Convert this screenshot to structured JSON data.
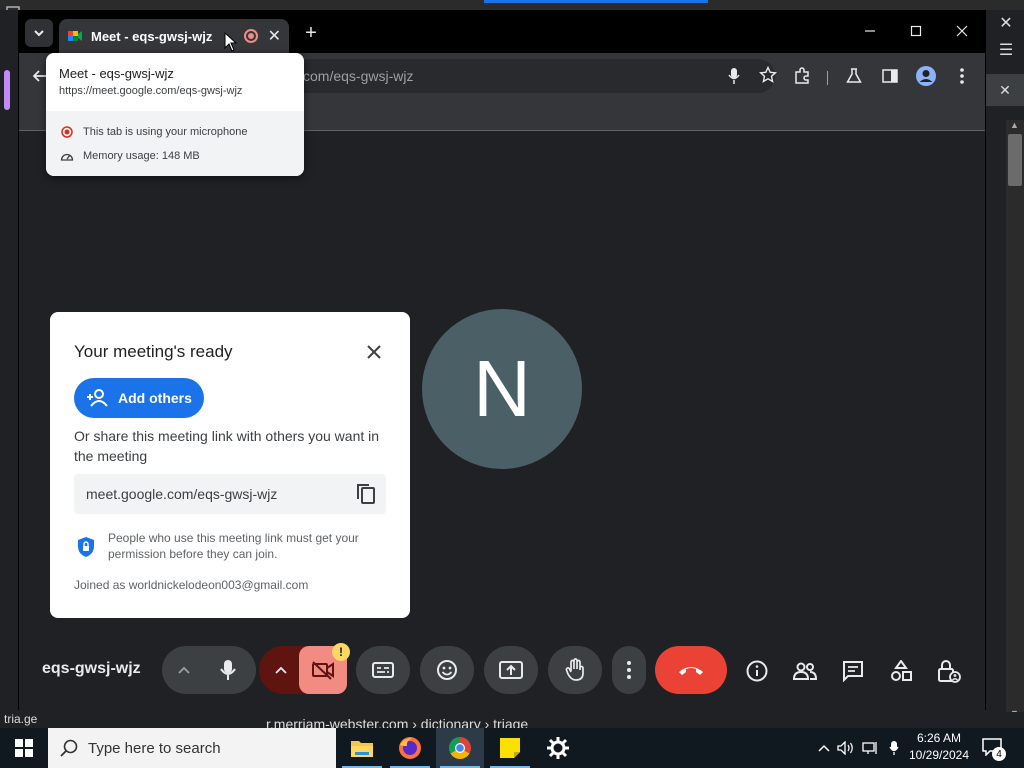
{
  "browser": {
    "tab_title": "Meet - eqs-gwsj-wjz",
    "omnibox_url": "com/eqs-gwsj-wjz",
    "new_tab_glyph": "+",
    "tab_close_glyph": "✕"
  },
  "hover_card": {
    "title": "Meet - eqs-gwsj-wjz",
    "url": "https://meet.google.com/eqs-gwsj-wjz",
    "mic_notice": "This tab is using your microphone",
    "memory": "Memory usage: 148 MB"
  },
  "dialog": {
    "title": "Your meeting's ready",
    "add_others": "Add others",
    "share_text": "Or share this meeting link with others you want in the meeting",
    "link": "meet.google.com/eqs-gwsj-wjz",
    "permission_text": "People who use this meeting link must get your permission before they can join.",
    "joined_as": "Joined as worldnickelodeon003@gmail.com"
  },
  "participant": {
    "initial": "N",
    "avatar_color": "#4a5f66"
  },
  "controls": {
    "meeting_code": "eqs-gwsj-wjz",
    "warning_badge": "!",
    "end_call_color": "#ea4335",
    "camera_off_color": "#f28b82"
  },
  "page_behind": {
    "status_text": "tria.ge",
    "breadcrumb": "r.merriam-webster.com › dictionary › triage"
  },
  "taskbar": {
    "search_placeholder": "Type here to search",
    "time": "6:26 AM",
    "date": "10/29/2024",
    "notification_count": "4",
    "apps": [
      "file-explorer",
      "firefox",
      "chrome",
      "sticky-notes",
      "settings"
    ]
  }
}
